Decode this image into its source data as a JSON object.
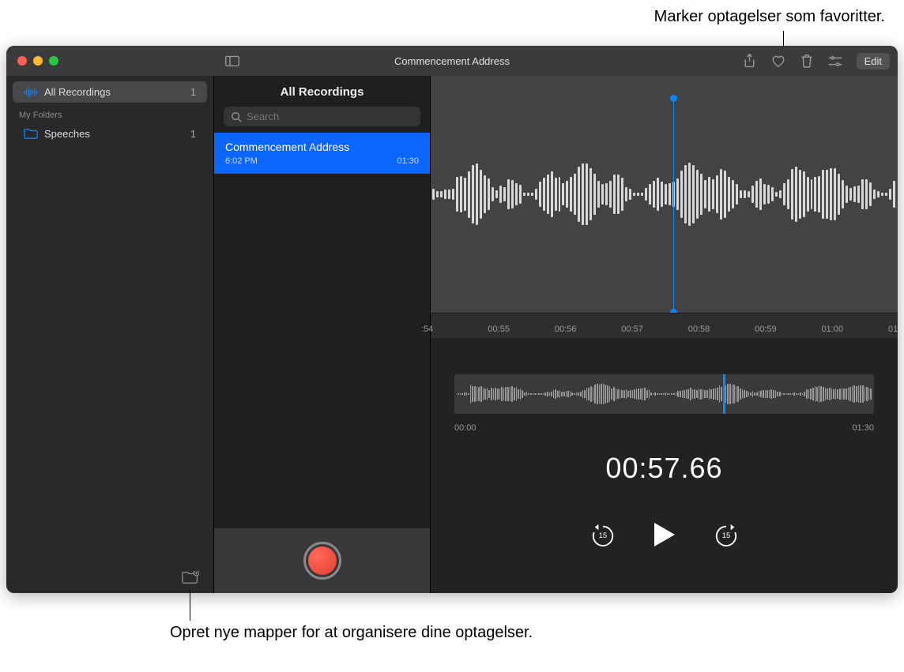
{
  "callouts": {
    "top": "Marker optagelser som favoritter.",
    "bottom": "Opret nye mapper for at organisere dine optagelser."
  },
  "titlebar": {
    "title": "Commencement Address",
    "edit_label": "Edit"
  },
  "sidebar": {
    "all_recordings": {
      "label": "All Recordings",
      "count": "1"
    },
    "my_folders_heading": "My Folders",
    "folders": [
      {
        "label": "Speeches",
        "count": "1"
      }
    ]
  },
  "list": {
    "header": "All Recordings",
    "search_placeholder": "Search",
    "items": [
      {
        "title": "Commencement Address",
        "time": "6:02 PM",
        "duration": "01:30"
      }
    ]
  },
  "ruler": {
    "ticks": [
      ":54",
      "00:55",
      "00:56",
      "00:57",
      "00:58",
      "00:59",
      "01:00",
      "01"
    ]
  },
  "overview": {
    "start": "00:00",
    "end": "01:30"
  },
  "timecode": "00:57.66",
  "transport": {
    "skip_back": "15",
    "skip_fwd": "15"
  },
  "colors": {
    "accent": "#0a84ff",
    "record": "#e0372a"
  }
}
